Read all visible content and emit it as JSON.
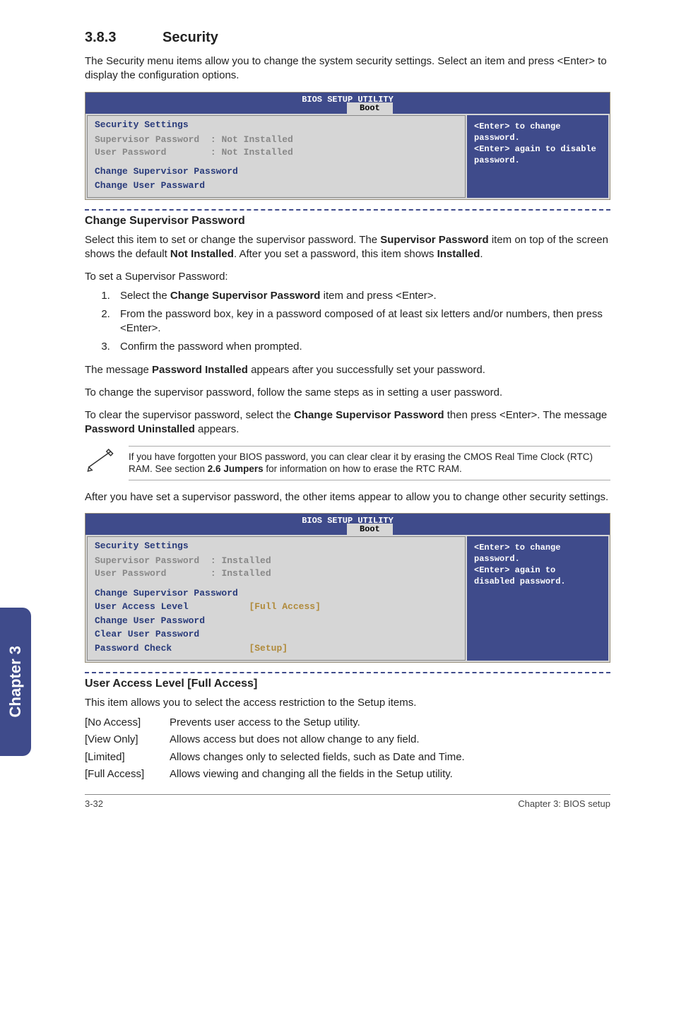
{
  "section": {
    "number": "3.8.3",
    "title": "Security"
  },
  "intro": "The Security menu items allow you to change the system security settings. Select an item and press <Enter> to display the configuration options.",
  "bios1": {
    "title": "BIOS SETUP UTILITY",
    "tab": "Boot",
    "left_header": "Security Settings",
    "sup_label": "Supervisor Password",
    "sup_val": ": Not Installed",
    "user_label": "User Password",
    "user_val": ": Not Installed",
    "menu1": "Change Supervisor Password",
    "menu2": "Change User Passward",
    "help": "<Enter> to change password.\n<Enter> again to disable password."
  },
  "h_change_sup": "Change Supervisor Password",
  "para1": "Select this item to set or change the supervisor password. The ",
  "para1_b1": "Supervisor Password",
  "para1_mid": " item on top of the screen shows the default ",
  "para1_b2": "Not Installed",
  "para1_end": ". After you set a password, this item shows ",
  "para1_b3": "Installed",
  "para1_dot": ".",
  "to_set": "To set a Supervisor Password:",
  "steps": {
    "s1a": "Select the ",
    "s1b": "Change Supervisor Password",
    "s1c": " item and press <Enter>.",
    "s2": "From the password box, key in a password composed of at least six letters and/or numbers, then press <Enter>.",
    "s3": "Confirm the password when prompted."
  },
  "msg1a": "The message ",
  "msg1b": "Password Installed",
  "msg1c": " appears after you successfully set your password.",
  "para_change": "To change the supervisor password, follow the same steps as in setting a user password.",
  "clear_a": "To clear the supervisor password, select the ",
  "clear_b": "Change Supervisor Password",
  "clear_c": " then press <Enter>. The message ",
  "clear_d": "Password Uninstalled",
  "clear_e": " appears.",
  "note_a": "If you have forgotten your BIOS password, you can clear clear it by erasing the CMOS Real Time Clock (RTC) RAM. See section ",
  "note_b": "2.6 Jumpers",
  "note_c": " for information on how to erase the RTC RAM.",
  "after": "After you have set a supervisor password, the other items appear to allow you to change other security settings.",
  "bios2": {
    "title": "BIOS SETUP UTILITY",
    "tab": "Boot",
    "left_header": "Security Settings",
    "sup_label": "Supervisor Password",
    "sup_val": ": Installed",
    "user_label": "User Password",
    "user_val": ": Installed",
    "menu1": "Change Supervisor Password",
    "menu2_label": "User Access Level",
    "menu2_val": "[Full Access]",
    "menu3": "Change User Password",
    "menu4": "Clear User Password",
    "menu5_label": "Password Check",
    "menu5_val": "[Setup]",
    "help": "<Enter> to change password.\n<Enter> again to disabled password."
  },
  "h_user_access": "User Access Level [Full Access]",
  "ua_intro": "This item allows you to select the access restriction to the Setup items.",
  "opts": {
    "k1": "[No Access]",
    "v1": "Prevents user access to the Setup utility.",
    "k2": "[View Only]",
    "v2": "Allows access but does not allow change to any field.",
    "k3": "[Limited]",
    "v3": "Allows changes only to selected fields, such as Date and Time.",
    "k4": "[Full Access]",
    "v4": "Allows viewing and changing all the fields in the Setup utility."
  },
  "side_tab": "Chapter 3",
  "footer": {
    "left": "3-32",
    "right": "Chapter 3: BIOS setup"
  }
}
